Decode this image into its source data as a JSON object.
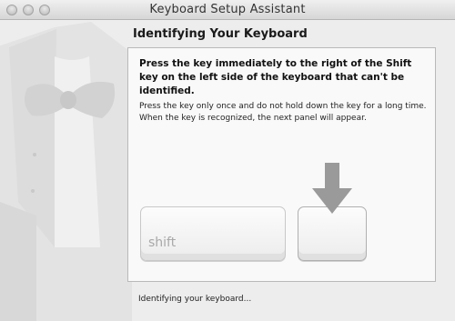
{
  "window": {
    "title": "Keyboard Setup Assistant"
  },
  "content": {
    "heading": "Identifying Your Keyboard",
    "instruction": "Press the key immediately to the right of the Shift key on the left side of the keyboard that can't be identified.",
    "note": "Press the key only once and do not hold down the key for a long time. When the key is recognized, the next panel will appear.",
    "shift_key_label": "shift"
  },
  "status": {
    "text": "Identifying your keyboard..."
  },
  "icons": {
    "arrow": "down-arrow-icon",
    "watermark": "tuxedo-bowtie-icon"
  }
}
